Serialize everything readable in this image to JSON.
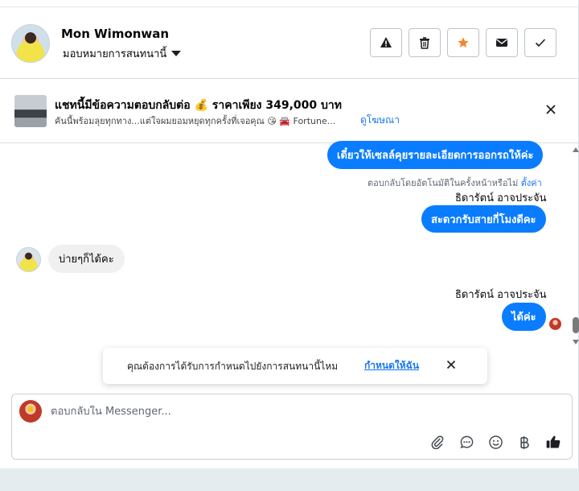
{
  "header": {
    "contact_name": "Mon Wimonwan",
    "assign_label": "มอบหมายการสนทนานี้",
    "actions": [
      "report-icon",
      "trash-icon",
      "star-icon",
      "mail-icon",
      "check-icon"
    ],
    "colors": {
      "star": "#f5862b"
    }
  },
  "ad": {
    "title": "แชทนี้มีข้อความตอบกลับต่อ 💰 ราคาเพียง 349,000 บาท",
    "description": "คันนี้พร้อมลุยทุกทาง...แต่ใจผมยอมหยุดทุกครั้งที่เจอคุณ 😘 🚘 Fortune...",
    "link": "ดูโฆษณา"
  },
  "messages": {
    "out1": "เดี๋ยวให้เซลล์คุยรายละเอียดการออกรถให้ค่ะ",
    "auto_reply_note": "ตอบกลับโดยอัตโนมัติในครั้งหน้าหรือไม่",
    "auto_reply_link": "ตั้งค่า",
    "sender1": "ธิดารัตน์ อาจประจัน",
    "out2": "สะดวกรับสายกี่โมงดีคะ",
    "in1": "บ่ายๆก็ได้คะ",
    "sender2": "ธิดารัตน์ อาจประจัน",
    "out3": "ได้ค่ะ",
    "colors": {
      "outgoing": "#0a7cff",
      "incoming": "#f0f0f0"
    }
  },
  "reminder": {
    "text": "คุณต้องการได้รับการกำหนดไปยังการสนทนานี้ไหม",
    "link": "กำหนดให้ฉัน"
  },
  "composer": {
    "placeholder": "ตอบกลับใน Messenger...",
    "tools": [
      "attach-icon",
      "chat-bubble-icon",
      "emoji-icon",
      "baht-icon",
      "like-icon"
    ]
  }
}
